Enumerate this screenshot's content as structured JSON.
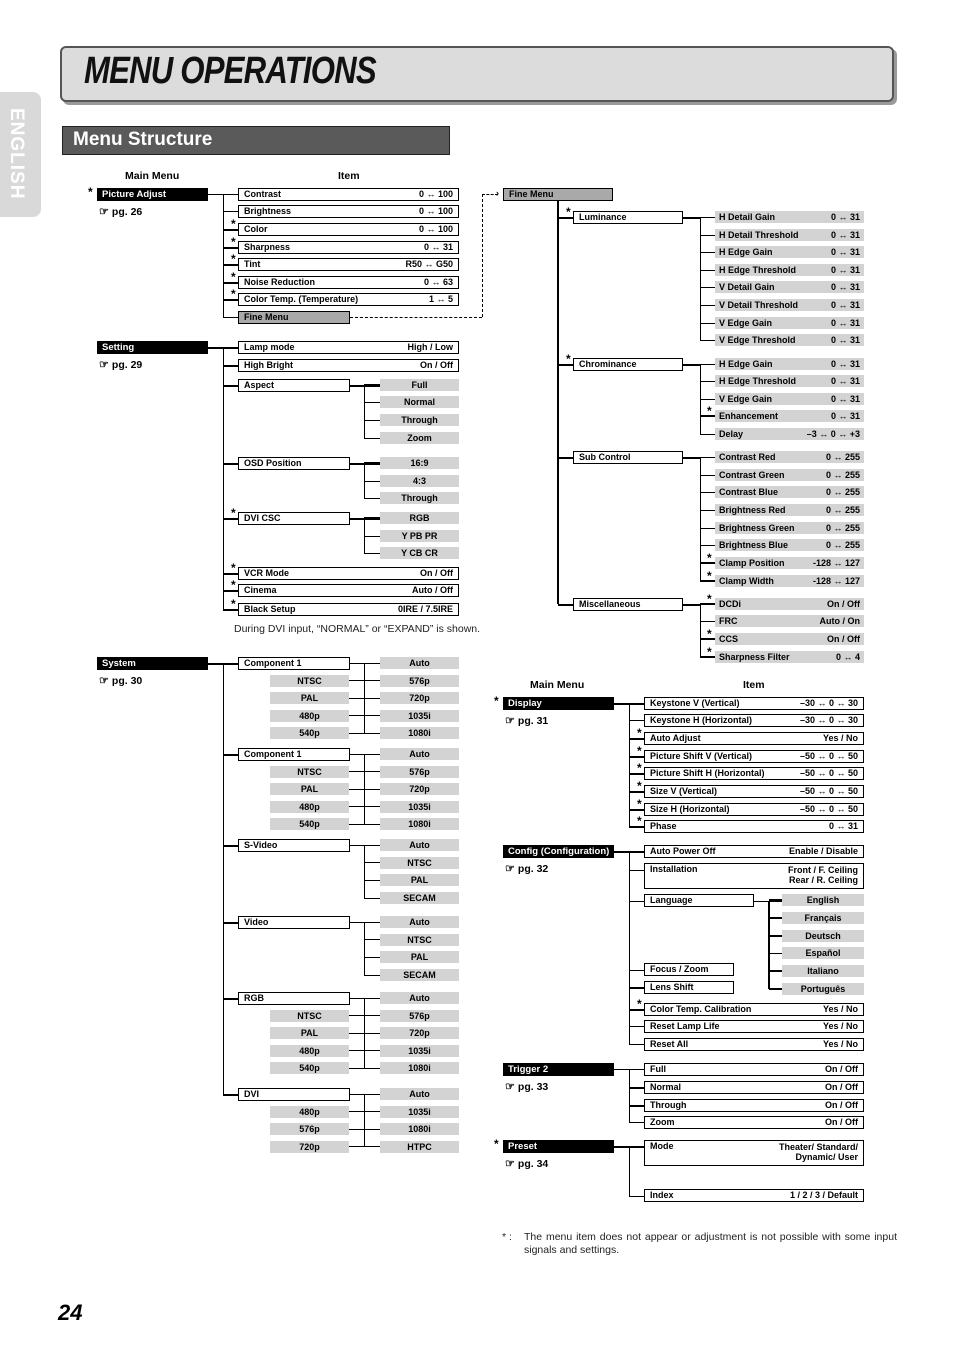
{
  "page": {
    "title": "MENU OPERATIONS",
    "language_tab": "ENGLISH",
    "section_title": "Menu Structure",
    "page_number": "24",
    "headers": {
      "main_menu": "Main Menu",
      "item": "Item"
    },
    "footnote": {
      "mark": "* :",
      "text": "The menu item does not appear or adjustment is not possible with some input signals and settings."
    },
    "dvi_note": "During DVI input, “NORMAL” or “EXPAND” is shown.",
    "page_ref_icon": "hand-pointer-icon"
  },
  "picture_adjust": {
    "label": "Picture Adjust",
    "page_ref": "pg. 26",
    "starred": true,
    "items": [
      {
        "label": "Contrast",
        "value": "0  ↔ 100",
        "starred": false
      },
      {
        "label": "Brightness",
        "value": "0  ↔ 100",
        "starred": false
      },
      {
        "label": "Color",
        "value": "0  ↔ 100",
        "starred": true
      },
      {
        "label": "Sharpness",
        "value": "0  ↔  31",
        "starred": true
      },
      {
        "label": "Tint",
        "value": "R50 ↔ G50",
        "starred": true
      },
      {
        "label": "Noise Reduction",
        "value": "0  ↔  63",
        "starred": true
      },
      {
        "label": "Color Temp. (Temperature)",
        "value": "1  ↔  5",
        "starred": true
      },
      {
        "label": "Fine Menu",
        "value": "",
        "starred": false
      }
    ]
  },
  "fine_menu": {
    "label": "Fine Menu",
    "groups": [
      {
        "label": "Luminance",
        "starred": true,
        "items": [
          {
            "label": "H Detail Gain",
            "value": "0  ↔  31",
            "starred": false
          },
          {
            "label": "H Detail Threshold",
            "value": "0  ↔  31",
            "starred": false
          },
          {
            "label": "H Edge Gain",
            "value": "0  ↔  31",
            "starred": false
          },
          {
            "label": "H Edge Threshold",
            "value": "0  ↔  31",
            "starred": false
          },
          {
            "label": "V Detail Gain",
            "value": "0  ↔  31",
            "starred": false
          },
          {
            "label": "V Detail Threshold",
            "value": "0  ↔  31",
            "starred": false
          },
          {
            "label": "V Edge Gain",
            "value": "0  ↔  31",
            "starred": false
          },
          {
            "label": "V Edge Threshold",
            "value": "0  ↔  31",
            "starred": false
          }
        ]
      },
      {
        "label": "Chrominance",
        "starred": true,
        "items": [
          {
            "label": "H Edge Gain",
            "value": "0  ↔  31",
            "starred": false
          },
          {
            "label": "H Edge Threshold",
            "value": "0  ↔  31",
            "starred": false
          },
          {
            "label": "V Edge Gain",
            "value": "0  ↔  31",
            "starred": false
          },
          {
            "label": "Enhancement",
            "value": "0  ↔  31",
            "starred": true
          },
          {
            "label": "Delay",
            "value": "–3 ↔ 0 ↔ +3",
            "starred": false
          }
        ]
      },
      {
        "label": "Sub Control",
        "starred": false,
        "items": [
          {
            "label": "Contrast Red",
            "value": "0  ↔ 255",
            "starred": false
          },
          {
            "label": "Contrast Green",
            "value": "0  ↔ 255",
            "starred": false
          },
          {
            "label": "Contrast Blue",
            "value": "0  ↔ 255",
            "starred": false
          },
          {
            "label": "Brightness Red",
            "value": "0  ↔ 255",
            "starred": false
          },
          {
            "label": "Brightness Green",
            "value": "0  ↔ 255",
            "starred": false
          },
          {
            "label": "Brightness Blue",
            "value": "0  ↔ 255",
            "starred": false
          },
          {
            "label": "Clamp Position",
            "value": "-128 ↔ 127",
            "starred": true
          },
          {
            "label": "Clamp Width",
            "value": "-128 ↔ 127",
            "starred": true
          }
        ]
      },
      {
        "label": "Miscellaneous",
        "starred": false,
        "items": [
          {
            "label": "DCDi",
            "value": "On / Off",
            "starred": true
          },
          {
            "label": "FRC",
            "value": "Auto / On",
            "starred": false
          },
          {
            "label": "CCS",
            "value": "On / Off",
            "starred": true
          },
          {
            "label": "Sharpness Filter",
            "value": "0  ↔  4",
            "starred": true
          }
        ]
      }
    ]
  },
  "setting": {
    "label": "Setting",
    "page_ref": "pg. 29",
    "starred": false,
    "items": [
      {
        "label": "Lamp mode",
        "value": "High / Low",
        "starred": false
      },
      {
        "label": "High Bright",
        "value": "On / Off",
        "starred": false
      },
      {
        "label": "Aspect",
        "value": "",
        "starred": false,
        "options": [
          "Full",
          "Normal",
          "Through",
          "Zoom"
        ]
      },
      {
        "label": "OSD Position",
        "value": "",
        "starred": false,
        "options": [
          "16:9",
          "4:3",
          "Through"
        ]
      },
      {
        "label": "DVI CSC",
        "value": "",
        "starred": true,
        "options": [
          "RGB",
          "Y PB PR",
          "Y CB CR"
        ]
      },
      {
        "label": "VCR Mode",
        "value": "On / Off",
        "starred": true
      },
      {
        "label": "Cinema",
        "value": "Auto / Off",
        "starred": true
      },
      {
        "label": "Black Setup",
        "value": "0IRE / 7.5IRE",
        "starred": true
      }
    ]
  },
  "system": {
    "label": "System",
    "page_ref": "pg. 30",
    "starred": false,
    "groups": [
      {
        "label": "Component 1",
        "left": [
          "NTSC",
          "PAL",
          "480p",
          "540p"
        ],
        "right": [
          "Auto",
          "576p",
          "720p",
          "1035i",
          "1080i"
        ]
      },
      {
        "label": "Component 1",
        "left": [
          "NTSC",
          "PAL",
          "480p",
          "540p"
        ],
        "right": [
          "Auto",
          "576p",
          "720p",
          "1035i",
          "1080i"
        ]
      },
      {
        "label": "S-Video",
        "left": [],
        "right": [
          "Auto",
          "NTSC",
          "PAL",
          "SECAM"
        ]
      },
      {
        "label": "Video",
        "left": [],
        "right": [
          "Auto",
          "NTSC",
          "PAL",
          "SECAM"
        ]
      },
      {
        "label": "RGB",
        "left": [
          "NTSC",
          "PAL",
          "480p",
          "540p"
        ],
        "right": [
          "Auto",
          "576p",
          "720p",
          "1035i",
          "1080i"
        ]
      },
      {
        "label": "DVI",
        "left": [
          "480p",
          "576p",
          "720p"
        ],
        "right": [
          "Auto",
          "1035i",
          "1080i",
          "HTPC"
        ]
      }
    ]
  },
  "display": {
    "label": "Display",
    "page_ref": "pg. 31",
    "starred": true,
    "items": [
      {
        "label": "Keystone V (Vertical)",
        "value": "–30 ↔ 0 ↔ 30",
        "starred": false
      },
      {
        "label": "Keystone H (Horizontal)",
        "value": "–30 ↔ 0 ↔ 30",
        "starred": false
      },
      {
        "label": "Auto Adjust",
        "value": "Yes / No",
        "starred": true
      },
      {
        "label": "Picture Shift V (Vertical)",
        "value": "–50 ↔ 0 ↔ 50",
        "starred": true
      },
      {
        "label": "Picture Shift H (Horizontal)",
        "value": "–50 ↔ 0 ↔ 50",
        "starred": true
      },
      {
        "label": "Size V (Vertical)",
        "value": "–50 ↔ 0 ↔ 50",
        "starred": true
      },
      {
        "label": "Size H (Horizontal)",
        "value": "–50 ↔ 0 ↔ 50",
        "starred": true
      },
      {
        "label": "Phase",
        "value": "0  ↔  31",
        "starred": true
      }
    ]
  },
  "config": {
    "label": "Config (Configuration)",
    "page_ref": "pg. 32",
    "starred": false,
    "auto_power_off": {
      "label": "Auto Power Off",
      "value": "Enable / Disable"
    },
    "installation": {
      "label": "Installation",
      "value": "Front / F. Ceiling\nRear / R. Ceiling"
    },
    "language": {
      "label": "Language",
      "options": [
        "English",
        "Français",
        "Deutsch",
        "Español",
        "Italiano",
        "Português"
      ]
    },
    "focus_zoom": {
      "label": "Focus / Zoom"
    },
    "lens_shift": {
      "label": "Lens Shift"
    },
    "tail_items": [
      {
        "label": "Color Temp. Calibration",
        "value": "Yes / No",
        "starred": true
      },
      {
        "label": "Reset Lamp Life",
        "value": "Yes / No",
        "starred": false
      },
      {
        "label": "Reset All",
        "value": "Yes / No",
        "starred": false
      }
    ]
  },
  "trigger2": {
    "label": "Trigger 2",
    "page_ref": "pg. 33",
    "starred": false,
    "items": [
      {
        "label": "Full",
        "value": "On / Off"
      },
      {
        "label": "Normal",
        "value": "On / Off"
      },
      {
        "label": "Through",
        "value": "On / Off"
      },
      {
        "label": "Zoom",
        "value": "On / Off"
      }
    ]
  },
  "preset": {
    "label": "Preset",
    "page_ref": "pg. 34",
    "starred": true,
    "mode": {
      "label": "Mode",
      "value": "Theater/ Standard/\nDynamic/ User"
    },
    "index": {
      "label": "Index",
      "value": "1 / 2 / 3 / Default"
    }
  }
}
